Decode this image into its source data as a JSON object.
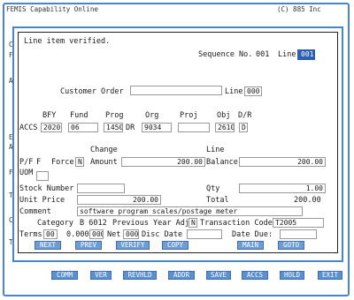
{
  "background": {
    "title_fragment_left": "FEMIS Capability Online",
    "title_fragment_right": "(C) 885 Inc",
    "side_letters": [
      "C",
      "F",
      "A",
      "E",
      "A",
      "F",
      "Ta",
      "C",
      "T"
    ]
  },
  "dialog": {
    "message": "Line item verified.",
    "sequence_label": "Sequence No.",
    "sequence_value": "001",
    "line_label": "Line",
    "line_value": "001",
    "customer_order_label": "Customer   Order",
    "customer_order_value": "",
    "line2_label": "Line",
    "line2_value": "000",
    "accs_label": "ACCS",
    "accs_headers": {
      "bfy": "BFY",
      "fund": "Fund",
      "prog": "Prog",
      "org": "Org",
      "proj": "Proj",
      "obj": "Obj",
      "dr": "D/R"
    },
    "accs_values": {
      "bfy": "2020",
      "fund": "06",
      "prog": "1450",
      "prog_dr": "DR",
      "org": "9034",
      "proj": "",
      "obj": "2610",
      "dr": "D"
    },
    "change_label": "Change",
    "line_header_label": "Line",
    "pf_label": "P/F",
    "pf_value": "F",
    "force_label": "Force",
    "force_value": "N",
    "amount_label": "Amount",
    "amount_value": "200.00",
    "balance_label": "Balance",
    "balance_value": "200.00",
    "uom_label": "UOM",
    "uom_value": "",
    "stock_number_label": "Stock Number",
    "stock_number_value": "",
    "qty_label": "Qty",
    "qty_value": "1.00",
    "unit_price_label": "Unit Price",
    "unit_price_value": "200.00",
    "total_label": "Total",
    "total_value": "200.00",
    "comment_label": "Comment",
    "comment_value": "software program scales/postage meter",
    "category_label": "Category",
    "category_value": "B 6012",
    "prev_year_adj_label": "Previous Year Adj",
    "prev_year_adj_value": "N",
    "transaction_code_label": "Transaction Code",
    "transaction_code_value": "T2005",
    "terms_label": "Terms",
    "terms_value_1": "00",
    "terms_value_2": "0.000",
    "terms_value_3": "000",
    "net_label": "Net",
    "net_value": "000",
    "disc_date_label": "Disc Date",
    "disc_date_value": "",
    "date_due_label": "Date Due:",
    "date_due_value": ""
  },
  "dialog_buttons": [
    "NEXT",
    "PREV",
    "VERIFY",
    "COPY",
    "MAIN",
    "GOTO"
  ],
  "outer_buttons": [
    "COMM",
    "VER",
    "REVHLD",
    "ADDR",
    "SAVE",
    "ACCS",
    "HOLD",
    "EXIT"
  ],
  "colors": {
    "accent": "#4a86c5",
    "button": "#6e9dd4",
    "active_field": "#2b5fb3"
  }
}
